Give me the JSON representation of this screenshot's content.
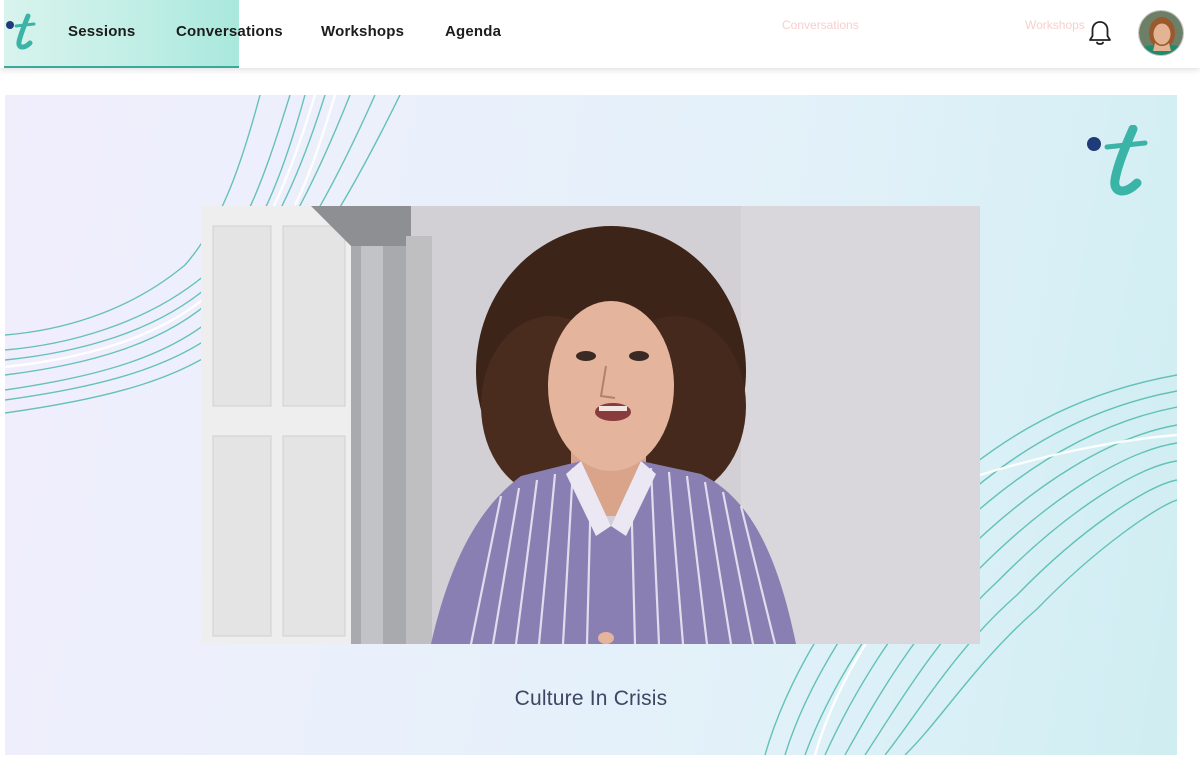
{
  "nav": {
    "items": [
      {
        "label": "Sessions",
        "active": true
      },
      {
        "label": "Conversations",
        "active": false
      },
      {
        "label": "Workshops",
        "active": false
      },
      {
        "label": "Agenda",
        "active": false
      }
    ],
    "ghost_items": [
      "Conversations",
      "Workshops"
    ]
  },
  "icons": {
    "logo": "t-logo-icon",
    "notifications": "bell-icon",
    "profile": "avatar"
  },
  "stage": {
    "caption": "Culture In Crisis"
  },
  "colors": {
    "accent_teal": "#3aa89a",
    "logo_dot": "#1f3b78",
    "caption_text": "#3e4663"
  }
}
